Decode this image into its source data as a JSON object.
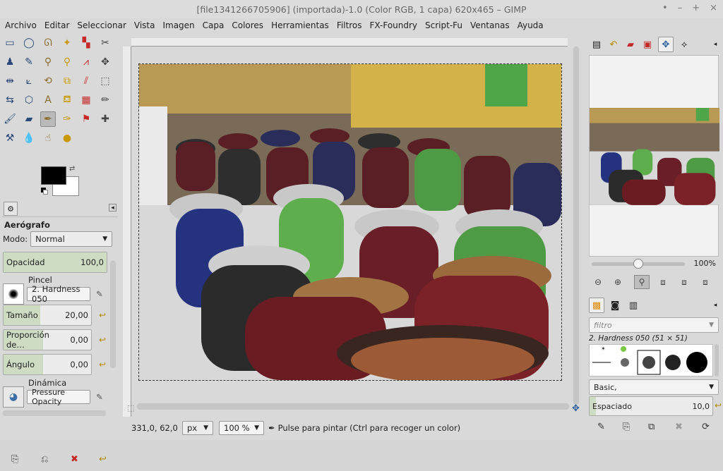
{
  "window": {
    "title": "[file1341266705906] (importada)-1.0 (Color RGB, 1 capa) 620x465 – GIMP",
    "controls": [
      "•",
      "–",
      "+",
      "×"
    ]
  },
  "menu": [
    "Archivo",
    "Editar",
    "Seleccionar",
    "Vista",
    "Imagen",
    "Capa",
    "Colores",
    "Herramientas",
    "Filtros",
    "FX-Foundry",
    "Script-Fu",
    "Ventanas",
    "Ayuda"
  ],
  "toolbox": {
    "tools": [
      {
        "name": "rect-select-icon",
        "glyph": "▭"
      },
      {
        "name": "ellipse-select-icon",
        "glyph": "◯"
      },
      {
        "name": "free-select-icon",
        "glyph": "ᘏ"
      },
      {
        "name": "fuzzy-select-icon",
        "glyph": "✦"
      },
      {
        "name": "color-select-icon",
        "glyph": "▚"
      },
      {
        "name": "scissors-icon",
        "glyph": "✂"
      },
      {
        "name": "foreground-select-icon",
        "glyph": "♟"
      },
      {
        "name": "paths-icon",
        "glyph": "✎"
      },
      {
        "name": "color-picker-icon",
        "glyph": "⚲"
      },
      {
        "name": "zoom-icon",
        "glyph": "⚲"
      },
      {
        "name": "measure-icon",
        "glyph": "⩘"
      },
      {
        "name": "move-icon",
        "glyph": "✥"
      },
      {
        "name": "align-icon",
        "glyph": "⇹"
      },
      {
        "name": "crop-icon",
        "glyph": "⟀"
      },
      {
        "name": "rotate-icon",
        "glyph": "⟲"
      },
      {
        "name": "scale-icon",
        "glyph": "⧉"
      },
      {
        "name": "shear-icon",
        "glyph": "⫽"
      },
      {
        "name": "perspective-icon",
        "glyph": "⬚"
      },
      {
        "name": "flip-icon",
        "glyph": "⇆"
      },
      {
        "name": "cage-icon",
        "glyph": "⬡"
      },
      {
        "name": "text-icon",
        "glyph": "A"
      },
      {
        "name": "bucket-fill-icon",
        "glyph": "⛾"
      },
      {
        "name": "blend-icon",
        "glyph": "▦"
      },
      {
        "name": "pencil-icon",
        "glyph": "✏"
      },
      {
        "name": "paintbrush-icon",
        "glyph": "🖌"
      },
      {
        "name": "eraser-icon",
        "glyph": "▰"
      },
      {
        "name": "airbrush-icon",
        "glyph": "✒"
      },
      {
        "name": "ink-icon",
        "glyph": "✑"
      },
      {
        "name": "clone-icon",
        "glyph": "⚑"
      },
      {
        "name": "heal-icon",
        "glyph": "✚"
      },
      {
        "name": "perspective-clone-icon",
        "glyph": "⚒"
      },
      {
        "name": "blur-icon",
        "glyph": "💧"
      },
      {
        "name": "smudge-icon",
        "glyph": "☝"
      },
      {
        "name": "dodge-burn-icon",
        "glyph": "●"
      }
    ],
    "options": {
      "title": "Aerógrafo",
      "mode_label": "Modo:",
      "mode_value": "Normal",
      "opacity_label": "Opacidad",
      "opacity_value": "100,0",
      "brush_label": "Pincel",
      "brush_value": "2. Hardness 050",
      "size_label": "Tamaño",
      "size_value": "20,00",
      "ratio_label": "Proporción de…",
      "ratio_value": "0,00",
      "angle_label": "Ángulo",
      "angle_value": "0,00",
      "dynamics_label": "Dinámica",
      "dynamics_value": "Pressure Opacity"
    }
  },
  "status": {
    "coords": "331,0, 62,0",
    "unit": "px",
    "zoom": "100 %",
    "message": "Pulse para pintar (Ctrl para recoger un color)"
  },
  "navigator": {
    "zoom_value": "100%",
    "zoom_fraction": 0.5
  },
  "brushes": {
    "filter_placeholder": "filtro",
    "selected_name": "2. Hardness 050 (51 × 51)",
    "tag_value": "Basic,",
    "spacing_label": "Espaciado",
    "spacing_value": "10,0",
    "spacing_fraction": 0.05
  }
}
